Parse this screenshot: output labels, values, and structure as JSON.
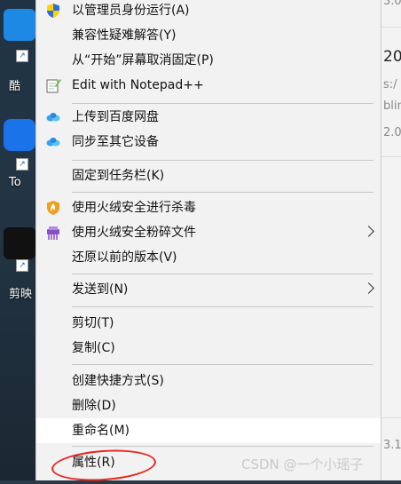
{
  "desktop": {
    "icons": [
      {
        "label": "酷"
      },
      {
        "label": "To"
      },
      {
        "label": "剪映"
      }
    ]
  },
  "background_window": {
    "texts": [
      "3.0",
      "20",
      "s:/",
      "blin",
      "2.08",
      "3.1"
    ]
  },
  "menu": {
    "items": [
      {
        "label": "以管理员身份运行(A)",
        "icon": "uac-shield-icon"
      },
      {
        "label": "兼容性疑难解答(Y)"
      },
      {
        "label": "从“开始”屏幕取消固定(P)"
      },
      {
        "label": "Edit with Notepad++",
        "icon": "notepad-plus-plus-icon"
      },
      {
        "label": "上传到百度网盘",
        "icon": "baidu-netdisk-icon"
      },
      {
        "label": "同步至其它设备",
        "icon": "baidu-sync-icon"
      },
      {
        "label": "固定到任务栏(K)"
      },
      {
        "label": "使用火绒安全进行杀毒",
        "icon": "huorong-shield-icon"
      },
      {
        "label": "使用火绒安全粉碎文件",
        "icon": "huorong-shredder-icon",
        "submenu": true
      },
      {
        "label": "还原以前的版本(V)"
      },
      {
        "label": "发送到(N)",
        "submenu": true
      },
      {
        "label": "剪切(T)"
      },
      {
        "label": "复制(C)"
      },
      {
        "label": "创建快捷方式(S)"
      },
      {
        "label": "删除(D)"
      },
      {
        "label": "重命名(M)",
        "hovered": true
      },
      {
        "label": "属性(R)",
        "annotated": true
      }
    ]
  },
  "watermark": "CSDN @一个小瑶子",
  "colors": {
    "menu_bg": "#f2f2f2",
    "hover_bg": "#ffffff",
    "annotation_red": "#e8261f",
    "separator": "#c8c8c8"
  }
}
